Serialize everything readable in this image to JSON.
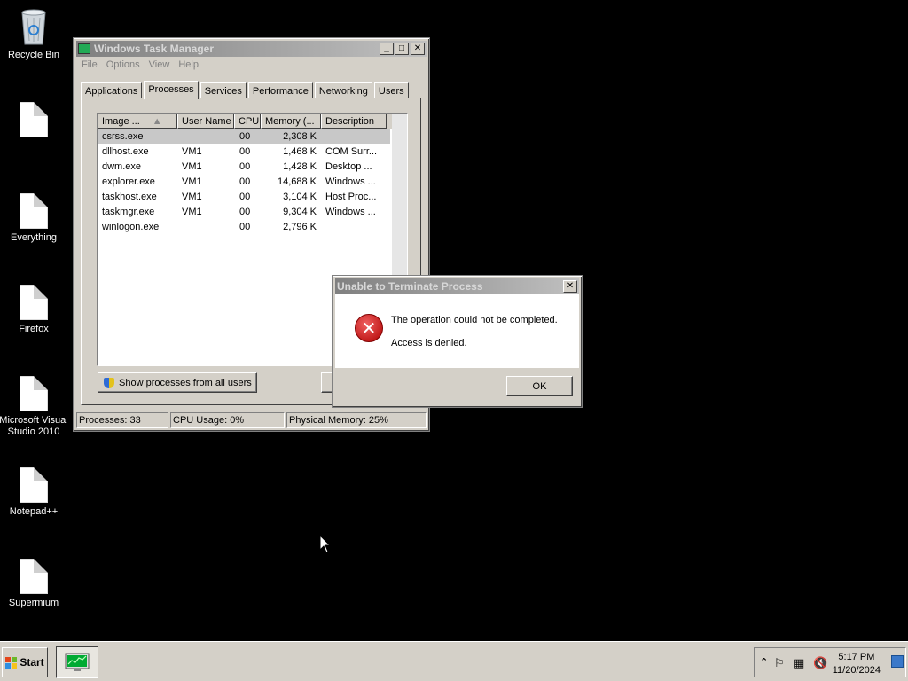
{
  "desktop": {
    "icons": [
      {
        "label": "Recycle Bin",
        "icon": "recycle-bin-icon"
      },
      {
        "label": "",
        "icon": "document-icon"
      },
      {
        "label": "Everything",
        "icon": "document-icon"
      },
      {
        "label": "Firefox",
        "icon": "document-icon"
      },
      {
        "label": "Microsoft Visual Studio 2010",
        "icon": "document-icon"
      },
      {
        "label": "Notepad++",
        "icon": "document-icon"
      },
      {
        "label": "Supermium",
        "icon": "document-icon"
      }
    ]
  },
  "task_manager": {
    "title": "Windows Task Manager",
    "menu": [
      "File",
      "Options",
      "View",
      "Help"
    ],
    "tabs": [
      "Applications",
      "Processes",
      "Services",
      "Performance",
      "Networking",
      "Users"
    ],
    "active_tab": "Processes",
    "columns": [
      "Image ...",
      "User Name",
      "CPU",
      "Memory (...",
      "Description"
    ],
    "processes": [
      {
        "image": "csrss.exe",
        "user": "",
        "cpu": "00",
        "memory": "2,308 K",
        "description": ""
      },
      {
        "image": "dllhost.exe",
        "user": "VM1",
        "cpu": "00",
        "memory": "1,468 K",
        "description": "COM Surr..."
      },
      {
        "image": "dwm.exe",
        "user": "VM1",
        "cpu": "00",
        "memory": "1,428 K",
        "description": "Desktop ..."
      },
      {
        "image": "explorer.exe",
        "user": "VM1",
        "cpu": "00",
        "memory": "14,688 K",
        "description": "Windows ..."
      },
      {
        "image": "taskhost.exe",
        "user": "VM1",
        "cpu": "00",
        "memory": "3,104 K",
        "description": "Host Proc..."
      },
      {
        "image": "taskmgr.exe",
        "user": "VM1",
        "cpu": "00",
        "memory": "9,304 K",
        "description": "Windows ..."
      },
      {
        "image": "winlogon.exe",
        "user": "",
        "cpu": "00",
        "memory": "2,796 K",
        "description": ""
      }
    ],
    "show_all_button": "Show processes from all users",
    "status": {
      "processes": "Processes: 33",
      "cpu": "CPU Usage: 0%",
      "memory": "Physical Memory: 25%"
    }
  },
  "dialog": {
    "title": "Unable to Terminate Process",
    "line1": "The operation could not be completed.",
    "line2": "Access is denied.",
    "ok": "OK"
  },
  "taskbar": {
    "start": "Start",
    "time": "5:17 PM",
    "date": "11/20/2024"
  }
}
